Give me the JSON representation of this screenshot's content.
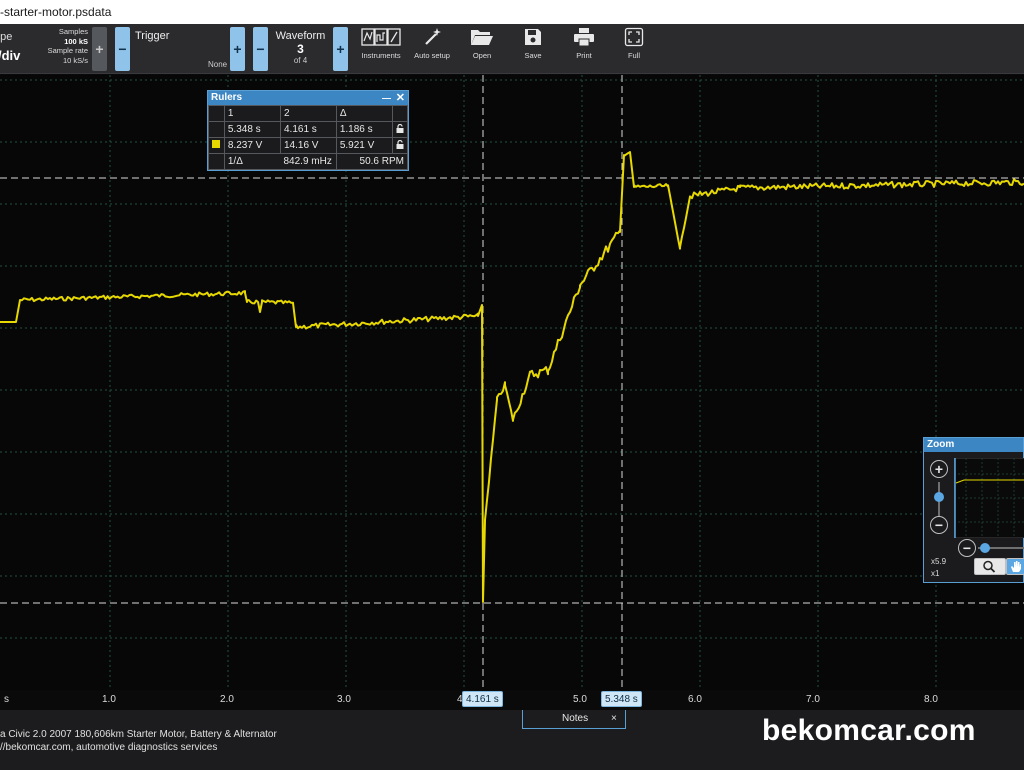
{
  "window": {
    "title": "-starter-motor.psdata"
  },
  "toolbar": {
    "scope_label": "ope",
    "scale_label": "/div",
    "samples_label": "Samples",
    "samples_value": "100 kS",
    "sample_rate_label": "Sample rate",
    "sample_rate_value": "10 kS/s",
    "trigger_label": "Trigger",
    "trigger_mode": "None",
    "waveform_label": "Waveform",
    "waveform_current": "3",
    "waveform_total": "of 4",
    "minus": "−",
    "plus": "+",
    "buttons": [
      {
        "label": "Instruments",
        "icon": "instruments-icon"
      },
      {
        "label": "Auto setup",
        "icon": "magic-wand-icon"
      },
      {
        "label": "Open",
        "icon": "folder-open-icon"
      },
      {
        "label": "Save",
        "icon": "floppy-save-icon"
      },
      {
        "label": "Print",
        "icon": "printer-icon"
      },
      {
        "label": "Full",
        "icon": "fullscreen-icon"
      }
    ]
  },
  "rulers_panel": {
    "title": "Rulers",
    "minimize": "—",
    "close": "✕",
    "headers": [
      "1",
      "2",
      "Δ"
    ],
    "time_row": [
      "5.348 s",
      "4.161 s",
      "1.186 s"
    ],
    "volt_row": [
      "8.237 V",
      "14.16 V",
      "5.921 V"
    ],
    "freq_label": "1/Δ",
    "freq_value": "842.9 mHz",
    "rpm_value": "50.6 RPM",
    "channel_color": "#e6d800"
  },
  "zoom_panel": {
    "title": "Zoom",
    "plus": "+",
    "minus": "−",
    "zoom_x": "x5.9",
    "zoom_y": "x1"
  },
  "x_axis": {
    "ticks": [
      {
        "label": "s",
        "value": 0.0
      },
      {
        "label": "1.0",
        "value": 1.0
      },
      {
        "label": "2.0",
        "value": 2.0
      },
      {
        "label": "3.0",
        "value": 3.0
      },
      {
        "label": "4",
        "value": 4.0
      },
      {
        "label": "5.0",
        "value": 5.0
      },
      {
        "label": "6.0",
        "value": 6.0
      },
      {
        "label": "7.0",
        "value": 7.0
      },
      {
        "label": "8.0",
        "value": 8.0
      }
    ],
    "ruler_flags": [
      "4.161 s",
      "5.348 s"
    ]
  },
  "trace": {
    "color": "#e6d800",
    "ruler_times_s": [
      4.161,
      5.348
    ],
    "ruler_levels_v": [
      14.16,
      8.237
    ]
  },
  "status": {
    "line1": "a Civic 2.0 2007 180,606km  Starter Motor, Battery & Alternator",
    "line2": "//bekomcar.com, automotive diagnostics services",
    "notes_tab": "Notes",
    "notes_close": "×",
    "brand": "bekomcar.com"
  }
}
